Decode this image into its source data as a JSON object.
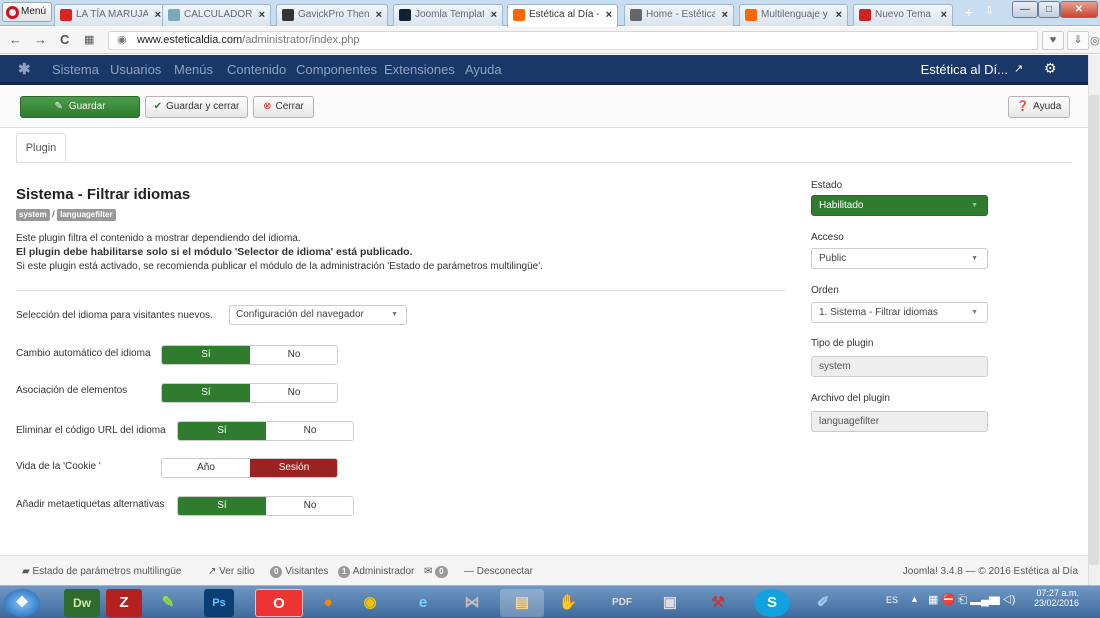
{
  "browser": {
    "menu_label": "Menú",
    "tabs": [
      {
        "label": "LA TÍA MARUJA",
        "close": "×",
        "favicon": "#d22"
      },
      {
        "label": "CALCULADORA",
        "close": "×",
        "favicon": "#7ab"
      },
      {
        "label": "GavickPro Then",
        "close": "×",
        "favicon": "#333"
      },
      {
        "label": "Joomla Templat",
        "close": "×",
        "favicon": "#123"
      },
      {
        "label": "Estética al Día -",
        "close": "×",
        "favicon": "#f60"
      },
      {
        "label": "Home - Estética",
        "close": "×",
        "favicon": "#666"
      },
      {
        "label": "Multilenguaje y",
        "close": "×",
        "favicon": "#f60"
      },
      {
        "label": "Nuevo Tema",
        "close": "×",
        "favicon": "#c22"
      }
    ],
    "new_tab": "+",
    "url_host": "www.esteticaldia.com",
    "url_path": "/administrator/index.php"
  },
  "joomla_menu": {
    "items": [
      "Sistema",
      "Usuarios",
      "Menús",
      "Contenido",
      "Componentes",
      "Extensiones",
      "Ayuda"
    ],
    "site_name": "Estética al Dí..."
  },
  "toolbar": {
    "save": "Guardar",
    "save_close": "Guardar y cerrar",
    "close": "Cerrar",
    "help": "Ayuda"
  },
  "tab_plugin": "Plugin",
  "plugin": {
    "title": "Sistema - Filtrar idiomas",
    "tag_group": "system",
    "tag_sep": "/",
    "tag_element": "languagefilter",
    "desc1": "Este plugin filtra el contenido a mostrar dependiendo del idioma.",
    "desc2": "El plugin debe habilitarse solo si el módulo 'Selector de idioma' está publicado.",
    "desc3": "Si este plugin está activado, se recomienda publicar el módulo de la administración 'Estado de parámetros multilingüe'."
  },
  "fields": {
    "new_visitors_label": "Selección del idioma para visitantes nuevos.",
    "new_visitors_value": "Configuración del navegador",
    "auto_change_label": "Cambio automático del idioma",
    "assoc_label": "Asociación de elementos",
    "remove_url_label": "Eliminar el código URL del idioma",
    "cookie_label": "Vida de la 'Cookie '",
    "meta_label": "Añadir metaetiquetas alternativas",
    "yes": "Sí",
    "no": "No",
    "year": "Año",
    "session": "Sesión"
  },
  "sidebar": {
    "state_label": "Estado",
    "state_value": "Habilitado",
    "access_label": "Acceso",
    "access_value": "Public",
    "order_label": "Orden",
    "order_value": "1. Sistema - Filtrar idiomas",
    "type_label": "Tipo de plugin",
    "type_value": "system",
    "file_label": "Archivo del plugin",
    "file_value": "languagefilter"
  },
  "statusbar": {
    "multilang": "Estado de parámetros multilingüe",
    "view_site": "Ver sitio",
    "visitors_count": "0",
    "visitors": "Visitantes",
    "admin_count": "1",
    "admin": "Administrador",
    "msg_count": "0",
    "logout": "Desconectar",
    "version": "Joomla! 3.4.8 — © 2016 Estética al Día"
  },
  "taskbar": {
    "lang": "ES",
    "time": "07:27 a.m.",
    "date": "23/02/2016"
  },
  "colors": {
    "joomla_bar": "#1a3867",
    "green": "#2f7c2f",
    "red": "#9c2121"
  }
}
